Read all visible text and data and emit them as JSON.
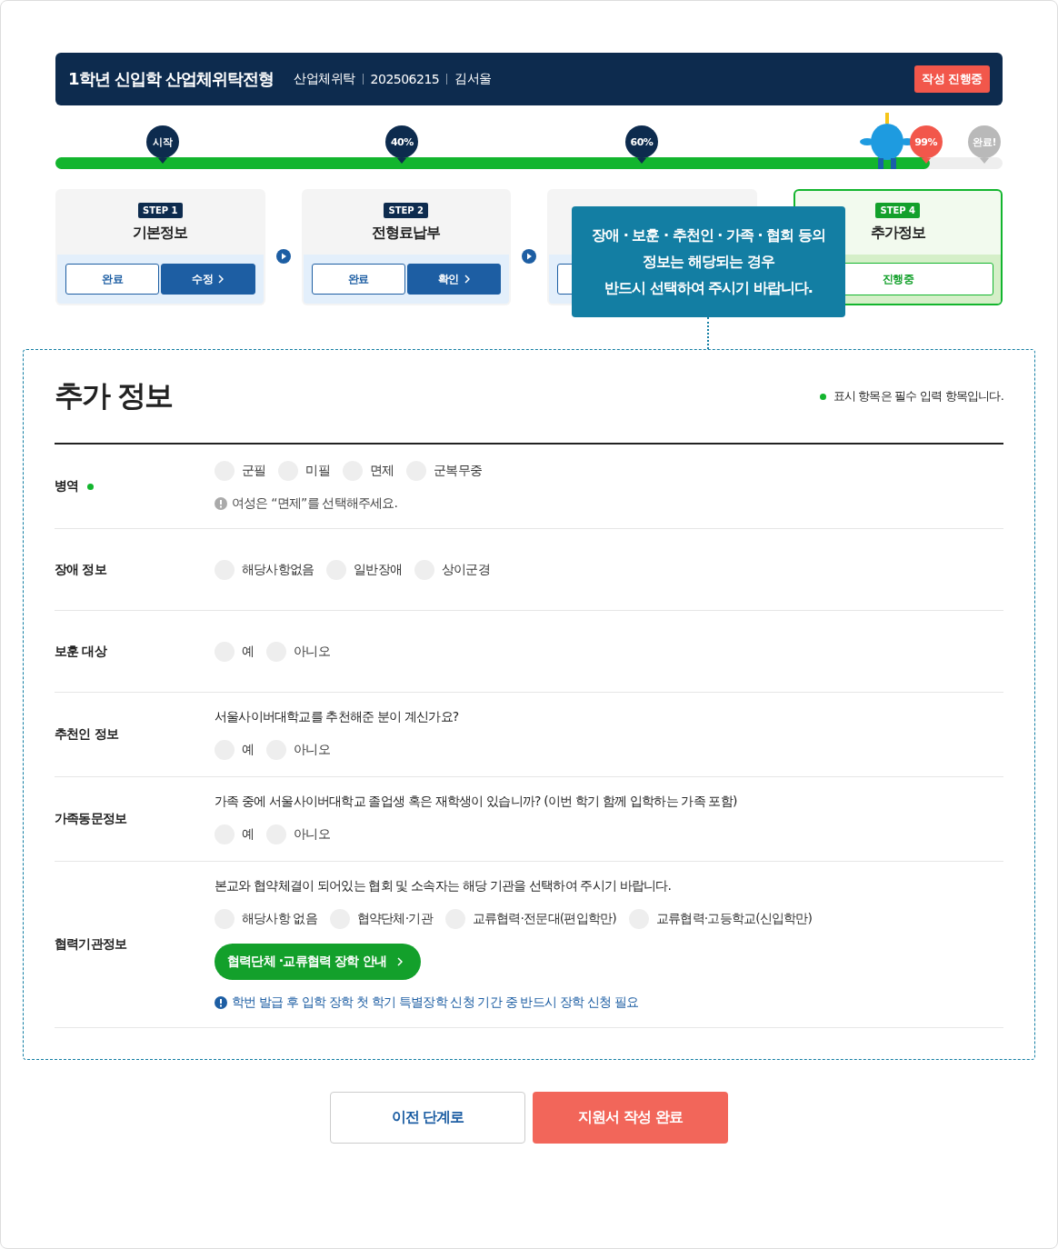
{
  "header": {
    "title": "1학년 신입학 산업체위탁전형",
    "meta": [
      "산업체위탁",
      "202506215",
      "김서울"
    ],
    "badge": "작성 진행중"
  },
  "progress": {
    "level": 0.923,
    "markers": [
      {
        "label": "시작",
        "kind": "reached"
      },
      {
        "label": "40%",
        "kind": "reached"
      },
      {
        "label": "60%",
        "kind": "reached"
      },
      {
        "label": "99%",
        "kind": "current"
      },
      {
        "label": "완료!",
        "kind": "pending"
      }
    ]
  },
  "steps": [
    {
      "badge": "STEP 1",
      "title": "기본정보",
      "current": false,
      "buttons": [
        "완료",
        "수정"
      ]
    },
    {
      "badge": "STEP 2",
      "title": "전형료납부",
      "current": false,
      "buttons": [
        "완료",
        "확인"
      ]
    },
    {
      "current": false
    },
    {
      "badge": "STEP 4",
      "title": "추가정보",
      "current": true,
      "buttons": [
        "진행중"
      ]
    }
  ],
  "tooltip": {
    "lines": [
      "장애 · 보훈 · 추천인 · 가족 · 협회 등의",
      "정보는 해당되는 경우",
      "반드시 선택하여 주시기 바랍니다."
    ]
  },
  "section": {
    "title": "추가 정보",
    "required_note": "표시 항목은 필수 입력 항목입니다.",
    "rows": [
      {
        "label": "병역",
        "required": true,
        "options": [
          {
            "label": "군필",
            "selected": false
          },
          {
            "label": "미필",
            "selected": false
          },
          {
            "label": "면제",
            "selected": false
          },
          {
            "label": "군복무중",
            "selected": false
          }
        ],
        "hint": "여성은 “면제”를 선택해주세요."
      },
      {
        "label": "장애 정보",
        "required": false,
        "options": [
          {
            "label": "해당사항없음",
            "selected": false
          },
          {
            "label": "일반장애",
            "selected": false
          },
          {
            "label": "상이군경",
            "selected": false
          }
        ]
      },
      {
        "label": "보훈 대상",
        "required": false,
        "options": [
          {
            "label": "예",
            "selected": false
          },
          {
            "label": "아니오",
            "selected": false
          }
        ]
      },
      {
        "label": "추천인 정보",
        "required": false,
        "question": "서울사이버대학교를 추천해준 분이 계신가요?",
        "options": [
          {
            "label": "예",
            "selected": false
          },
          {
            "label": "아니오",
            "selected": false
          }
        ]
      },
      {
        "label": "가족동문정보",
        "required": false,
        "question": "가족 중에 서울사이버대학교 졸업생 혹은 재학생이 있습니까? (이번 학기 함께 입학하는 가족 포함)",
        "options": [
          {
            "label": "예",
            "selected": false
          },
          {
            "label": "아니오",
            "selected": false
          }
        ]
      },
      {
        "label": "협력기관정보",
        "required": false,
        "question": "본교와 협약체결이 되어있는 협회 및 소속자는 해당 기관을 선택하여 주시기 바랍니다.",
        "options": [
          {
            "label": "해당사항 없음",
            "selected": false
          },
          {
            "label": "협약단체·기관",
            "selected": false
          },
          {
            "label": "교류협력·전문대(편입학만)",
            "selected": false
          },
          {
            "label": "교류협력·고등학교(신입학만)",
            "selected": false
          }
        ],
        "link_button": "협력단체 ·교류협력 장학 안내",
        "notice": "학번 발급 후 입학 장학 첫 학기 특별장학 신청 기간 중 반드시 장학 신청 필요"
      }
    ]
  },
  "footer": {
    "buttons": [
      {
        "label": "이전 단계로",
        "kind": "secondary"
      },
      {
        "label": "지원서 작성 완료",
        "kind": "primary"
      }
    ]
  }
}
